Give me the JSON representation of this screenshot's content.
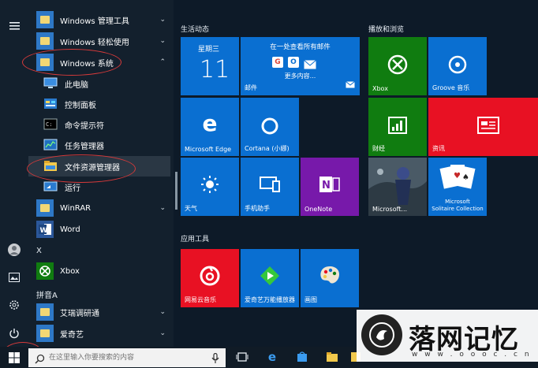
{
  "rail": {
    "icons": [
      "hamburger-menu-icon",
      "user-avatar-icon",
      "photos-icon",
      "settings-gear-icon",
      "power-icon"
    ]
  },
  "app_list": {
    "items": [
      {
        "label": "Windows 管理工具",
        "chevron": "⌄"
      },
      {
        "label": "Windows 轻松使用",
        "chevron": "⌄"
      },
      {
        "label": "Windows 系统",
        "chevron": "⌃"
      },
      {
        "label": "此电脑"
      },
      {
        "label": "控制面板"
      },
      {
        "label": "命令提示符"
      },
      {
        "label": "任务管理器"
      },
      {
        "label": "文件资源管理器"
      },
      {
        "label": "运行"
      },
      {
        "label": "WinRAR",
        "chevron": "⌄"
      },
      {
        "label": "Word"
      },
      {
        "label": "X"
      },
      {
        "label": "Xbox"
      },
      {
        "label": "拼音A"
      },
      {
        "label": "艾瑞调研通",
        "chevron": "⌄"
      },
      {
        "label": "爱奇艺",
        "chevron": "⌄"
      }
    ]
  },
  "groups": {
    "life": "生活动态",
    "play": "播放和浏览",
    "tools": "应用工具"
  },
  "tiles": {
    "calendar_day": "星期三",
    "calendar_date": "11",
    "mail_top": "在一处查看所有邮件",
    "mail_more": "更多内容...",
    "mail": "邮件",
    "edge": "Microsoft Edge",
    "cortana": "Cortana (小娜)",
    "weather": "天气",
    "phone": "手机助手",
    "onenote": "OneNote",
    "xbox": "Xbox",
    "groove": "Groove 音乐",
    "finance": "财经",
    "news": "资讯",
    "store": "Microsoft...",
    "solitaire_line1": "Microsoft",
    "solitaire_line2": "Solitaire Collection",
    "netease": "网易云音乐",
    "iqiyi": "爱奇艺万能播放器",
    "paint": "画图"
  },
  "taskbar": {
    "search_placeholder": "在这里输入你要搜索的内容"
  },
  "watermark": {
    "text": "落网记忆",
    "url": "w w w . o o o c . c n"
  },
  "colors": {
    "tile_blue": "#0a6fd1",
    "tile_red": "#e81123",
    "tile_green": "#107c10",
    "tile_purple": "#7719aa",
    "annotation_red": "#d63a3a"
  }
}
